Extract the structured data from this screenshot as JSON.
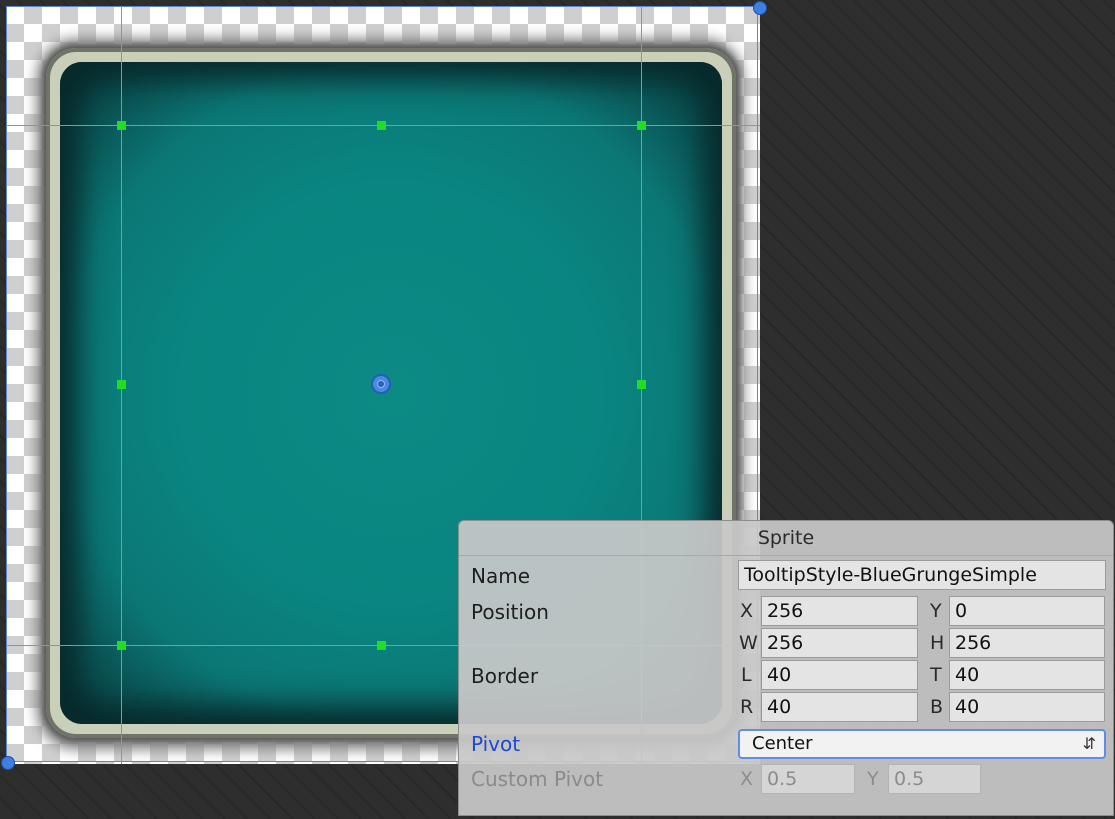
{
  "panel": {
    "title": "Sprite",
    "name_label": "Name",
    "name_value": "TooltipStyle-BlueGrungeSimple",
    "position_label": "Position",
    "x_axis": "X",
    "x_value": "256",
    "y_axis": "Y",
    "y_value": "0",
    "w_axis": "W",
    "w_value": "256",
    "h_axis": "H",
    "h_value": "256",
    "border_label": "Border",
    "l_axis": "L",
    "l_value": "40",
    "t_axis": "T",
    "t_value": "40",
    "r_axis": "R",
    "r_value": "40",
    "b_axis": "B",
    "b_value": "40",
    "pivot_label": "Pivot",
    "pivot_value": "Center",
    "custom_pivot_label": "Custom Pivot",
    "cp_x_axis": "X",
    "cp_x_value": "0.5",
    "cp_y_axis": "Y",
    "cp_y_value": "0.5"
  },
  "icons": {
    "pivot_arrows": "updown-arrows-icon",
    "pivot_handle": "pivot-circle-icon"
  },
  "colors": {
    "slice_line": "#22e322",
    "pivot_label": "#1a49d8",
    "sprite_fill": "#0a8581"
  }
}
